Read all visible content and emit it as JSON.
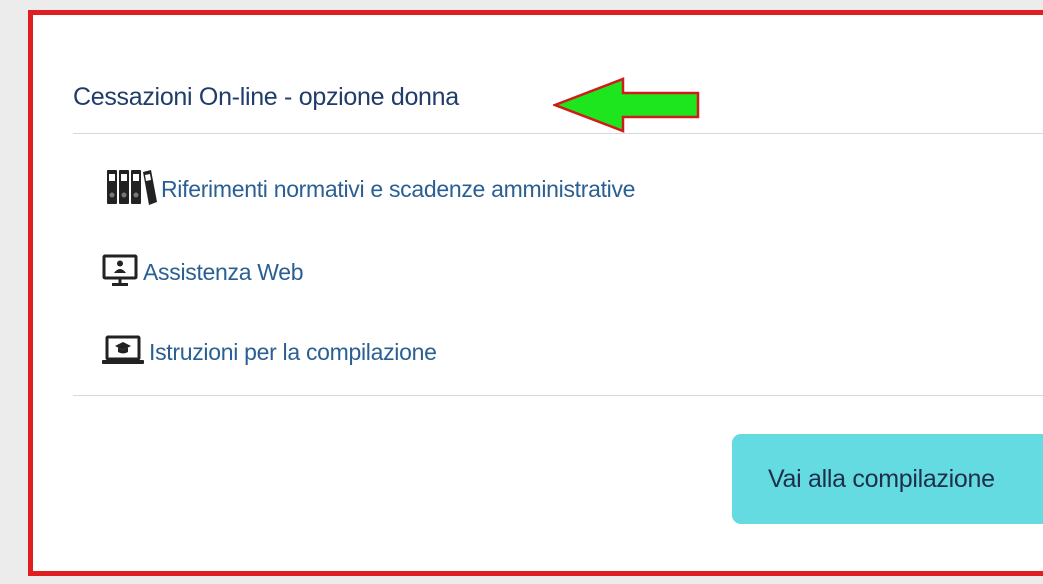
{
  "card": {
    "title": "Cessazioni On-line - opzione donna",
    "links": [
      {
        "label": "Riferimenti normativi e scadenze amministrative",
        "icon": "binders-icon"
      },
      {
        "label": "Assistenza Web",
        "icon": "monitor-support-icon"
      },
      {
        "label": "Istruzioni per la compilazione",
        "icon": "laptop-graduation-icon"
      }
    ],
    "cta_label": "Vai alla compilazione"
  },
  "colors": {
    "frame_border": "#e01e22",
    "title": "#1f3c6b",
    "link": "#2a5f94",
    "cta_bg": "#63dbe0",
    "arrow_fill": "#1ee61e",
    "arrow_stroke": "#d11a1a"
  }
}
